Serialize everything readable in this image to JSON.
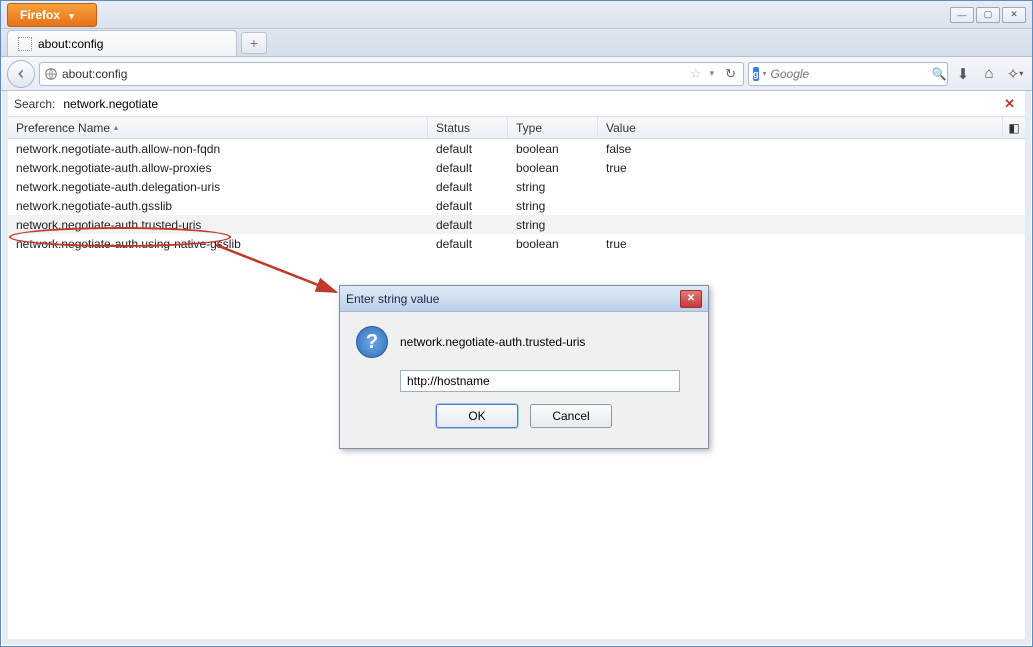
{
  "app": {
    "menu_label": "Firefox"
  },
  "tab": {
    "title": "about:config"
  },
  "url": {
    "value": "about:config"
  },
  "search_engine": {
    "letter": "g",
    "placeholder": "Google"
  },
  "config_search": {
    "label": "Search:",
    "value": "network.negotiate"
  },
  "columns": {
    "name": "Preference Name",
    "status": "Status",
    "type": "Type",
    "value": "Value"
  },
  "rows": [
    {
      "name": "network.negotiate-auth.allow-non-fqdn",
      "status": "default",
      "type": "boolean",
      "value": "false"
    },
    {
      "name": "network.negotiate-auth.allow-proxies",
      "status": "default",
      "type": "boolean",
      "value": "true"
    },
    {
      "name": "network.negotiate-auth.delegation-uris",
      "status": "default",
      "type": "string",
      "value": ""
    },
    {
      "name": "network.negotiate-auth.gsslib",
      "status": "default",
      "type": "string",
      "value": ""
    },
    {
      "name": "network.negotiate-auth.trusted-uris",
      "status": "default",
      "type": "string",
      "value": ""
    },
    {
      "name": "network.negotiate-auth.using-native-gsslib",
      "status": "default",
      "type": "boolean",
      "value": "true"
    }
  ],
  "selected_row_index": 4,
  "dialog": {
    "title": "Enter string value",
    "pref_name": "network.negotiate-auth.trusted-uris",
    "input_value": "http://hostname",
    "ok": "OK",
    "cancel": "Cancel"
  }
}
